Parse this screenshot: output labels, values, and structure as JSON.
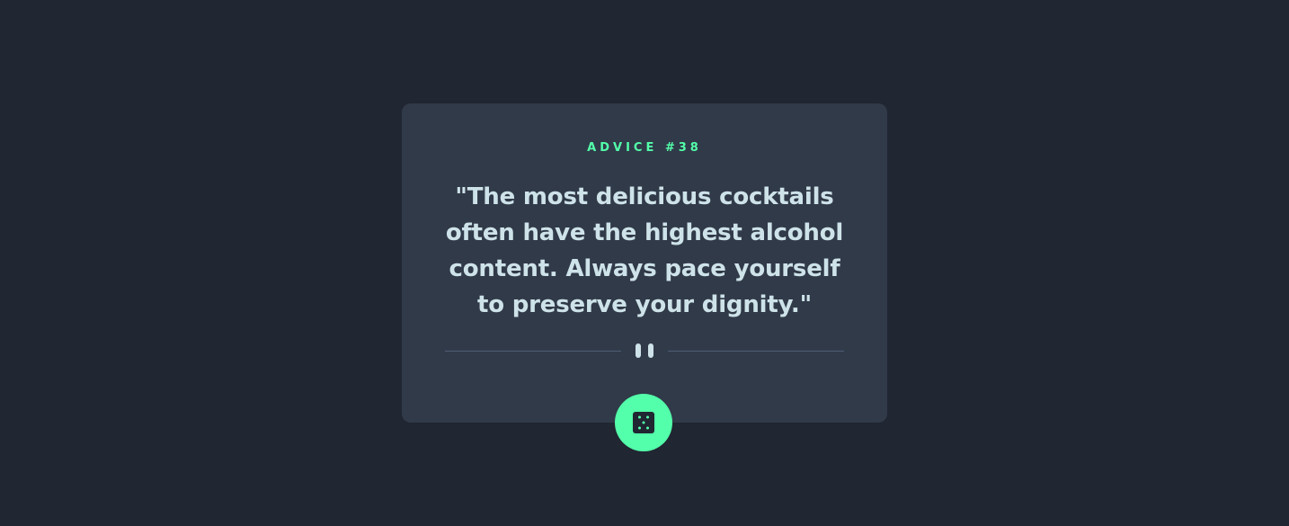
{
  "advice": {
    "label": "ADVICE #38",
    "quote": "\"The most delicious cocktails often have the highest alcohol content. Always pace yourself to preserve your dignity.\""
  },
  "icons": {
    "divider": "pause-icon",
    "button": "dice-icon"
  },
  "colors": {
    "background": "#202632",
    "card": "#313a49",
    "accent": "#53ffaa",
    "text": "#cee3e9",
    "divider": "#4f5d74"
  }
}
